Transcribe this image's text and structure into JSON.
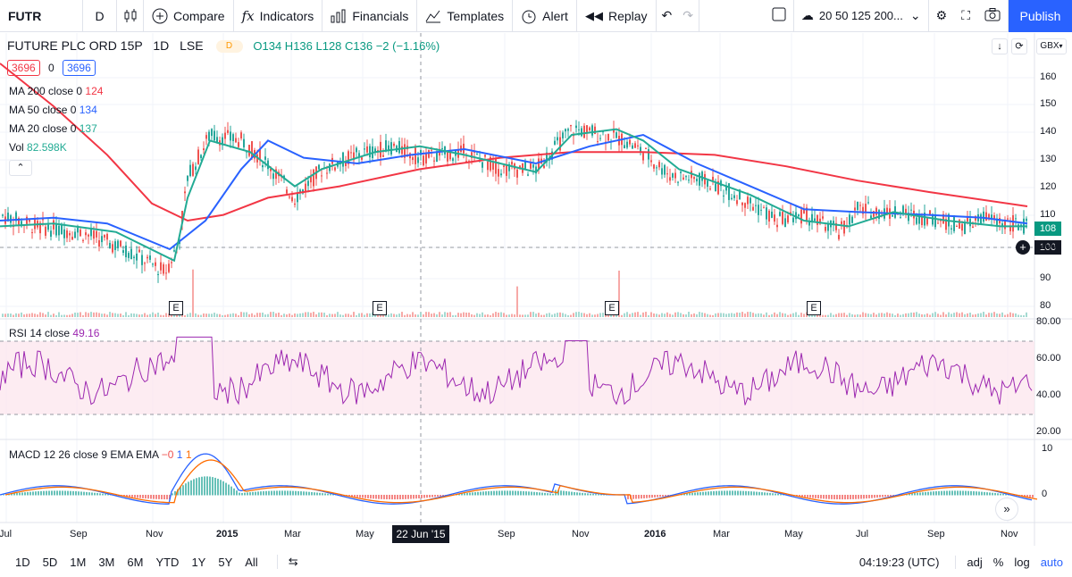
{
  "toolbar": {
    "symbol": "FUTR",
    "interval": "D",
    "compare": "Compare",
    "indicators": "Indicators",
    "financials": "Financials",
    "templates": "Templates",
    "alert": "Alert",
    "replay": "Replay",
    "layout_name": "20 50 125 200...",
    "publish": "Publish"
  },
  "header": {
    "title": "FUTURE PLC ORD 15P",
    "interval": "1D",
    "exchange": "LSE",
    "badge": "D",
    "ohlc": "O134 H136 L128 C136 −2 (−1.16%)",
    "currency": "GBX"
  },
  "legend": {
    "sell_price": "3696",
    "spread": "0",
    "buy_price": "3696",
    "ma200_label": "MA 200 close 0",
    "ma200_value": "124",
    "ma50_label": "MA 50 close 0",
    "ma50_value": "134",
    "ma20_label": "MA 20 close 0",
    "ma20_value": "137",
    "vol_label": "Vol",
    "vol_value": "82.598K"
  },
  "price_axis": [
    "160",
    "150",
    "140",
    "130",
    "120",
    "110",
    "100",
    "90",
    "80"
  ],
  "price_tags": {
    "current": "108",
    "crosshair": "100"
  },
  "rsi": {
    "label": "RSI 14 close",
    "value": "49.16",
    "axis": [
      "80.00",
      "60.00",
      "40.00",
      "20.00"
    ]
  },
  "macd": {
    "label": "MACD 12 26 close 9 EMA EMA",
    "hist": "−0",
    "macd": "1",
    "signal": "1",
    "axis": [
      "10",
      "0"
    ]
  },
  "time_axis": [
    "Jul",
    "Sep",
    "Nov",
    "2015",
    "Mar",
    "May",
    "Sep",
    "Nov",
    "2016",
    "Mar",
    "May",
    "Jul",
    "Sep",
    "Nov"
  ],
  "crosshair_date": "22 Jun '15",
  "earnings_marker": "E",
  "bottom": {
    "ranges": [
      "1D",
      "5D",
      "1M",
      "3M",
      "6M",
      "YTD",
      "1Y",
      "5Y",
      "All"
    ],
    "clock": "04:19:23 (UTC)",
    "adj": "adj",
    "percent": "%",
    "log": "log",
    "auto": "auto"
  },
  "colors": {
    "ma200": "#f23645",
    "ma50": "#2962ff",
    "ma20": "#22ab94",
    "up": "#26a69a",
    "down": "#ef5350",
    "rsi": "#9c27b0",
    "macd": "#2962ff",
    "signal": "#ff6d00",
    "accent": "#2962ff"
  }
}
